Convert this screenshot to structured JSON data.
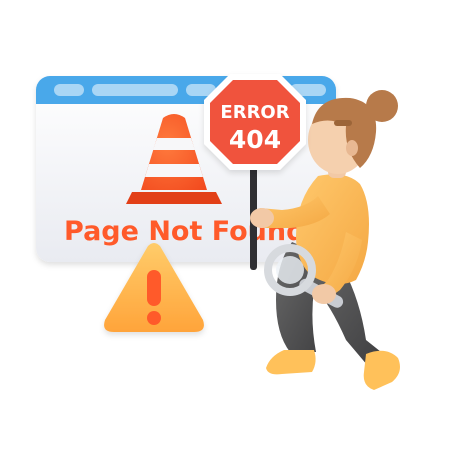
{
  "browser_window": {
    "message": "Page Not Found"
  },
  "stop_sign": {
    "line1": "ERROR",
    "line2": "404"
  },
  "colors": {
    "accent_orange": "#ff5a2a",
    "warning_yellow": "#ffb64a",
    "window_bar_blue": "#4aa8ea",
    "window_body": "#f2f3f6",
    "sign_red": "#f0523e"
  },
  "icons": [
    "traffic-cone-icon",
    "warning-triangle-icon",
    "magnifier-icon"
  ]
}
